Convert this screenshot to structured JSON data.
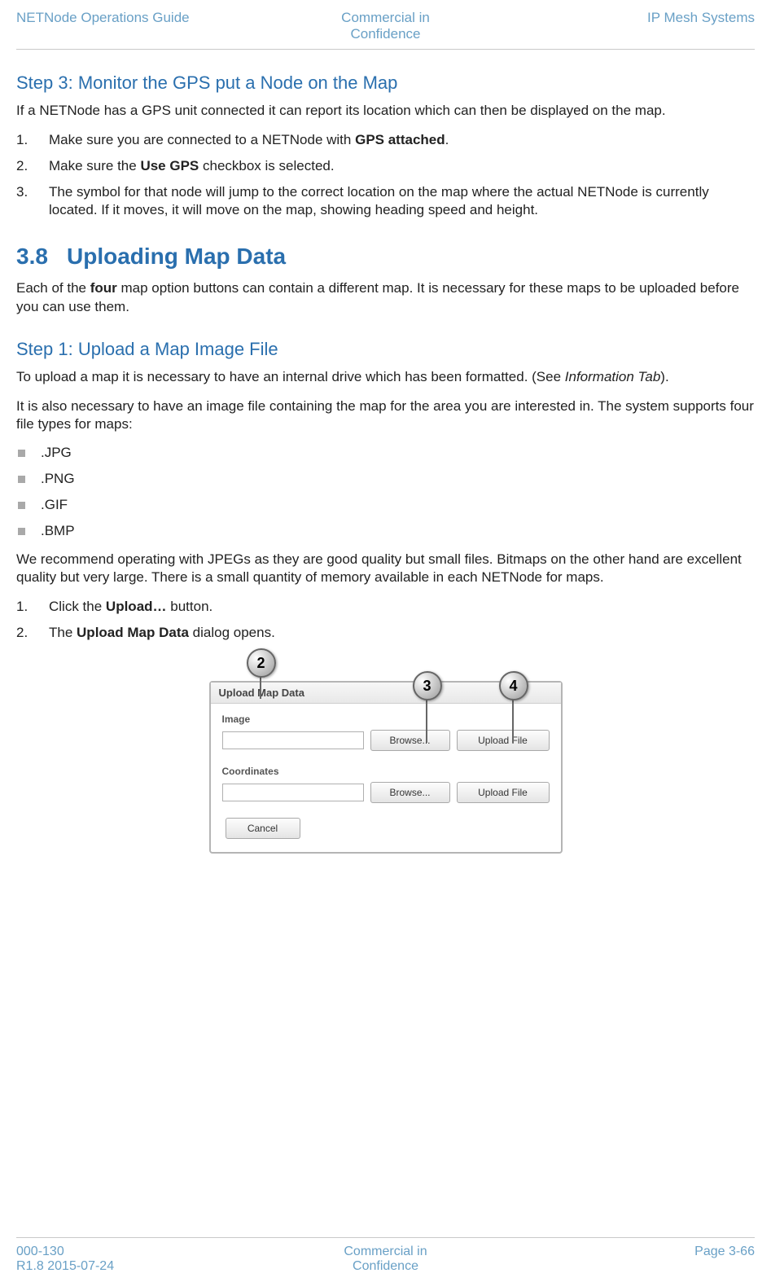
{
  "header": {
    "left": "NETNode Operations Guide",
    "center_line1": "Commercial in",
    "center_line2": "Confidence",
    "right": "IP Mesh Systems"
  },
  "step3": {
    "heading": "Step 3: Monitor the GPS put a Node on the Map",
    "intro": "If a NETNode has a GPS unit connected it can report its location which can then be displayed on the map.",
    "items": [
      {
        "pre": "Make sure you are connected to a NETNode with ",
        "bold": "GPS attached",
        "post": "."
      },
      {
        "pre": "Make sure the ",
        "bold": "Use GPS",
        "post": " checkbox is selected."
      },
      {
        "pre": "The symbol for that node will jump to the correct location on the map where the actual NETNode is currently located. If it moves, it will move on the map, showing heading speed and height.",
        "bold": "",
        "post": ""
      }
    ]
  },
  "sec38": {
    "num": "3.8",
    "title": "Uploading Map Data",
    "intro_pre": "Each of the ",
    "intro_bold": "four",
    "intro_post": " map option buttons can contain a different map. It is necessary for these maps to be uploaded before you can use them."
  },
  "step1": {
    "heading": "Step 1: Upload a Map Image File",
    "p1_pre": "To upload a map it is necessary to have an internal drive which has been formatted. (See ",
    "p1_italic": "Information Tab",
    "p1_post": ").",
    "p2": "It is also necessary to have an image file containing the map for the area you are interested in. The system supports four file types for maps:",
    "filetypes": [
      ".JPG",
      ".PNG",
      ".GIF",
      ".BMP"
    ],
    "p3": "We recommend operating with JPEGs as they are good quality but small files. Bitmaps on the other hand are excellent quality but very large. There is a small quantity of memory available in each NETNode for maps.",
    "steps": [
      {
        "pre": "Click the ",
        "bold": "Upload…",
        "post": " button."
      },
      {
        "pre": "The ",
        "bold": "Upload Map Data",
        "post": " dialog opens."
      }
    ]
  },
  "dialog": {
    "title": "Upload Map Data",
    "group1": "Image",
    "group2": "Coordinates",
    "browse": "Browse...",
    "upload": "Upload File",
    "cancel": "Cancel",
    "callouts": {
      "c2": "2",
      "c3": "3",
      "c4": "4"
    }
  },
  "footer": {
    "left_line1": "000-130",
    "left_line2": "R1.8 2015-07-24",
    "center_line1": "Commercial in",
    "center_line2": "Confidence",
    "right": "Page 3-66"
  }
}
